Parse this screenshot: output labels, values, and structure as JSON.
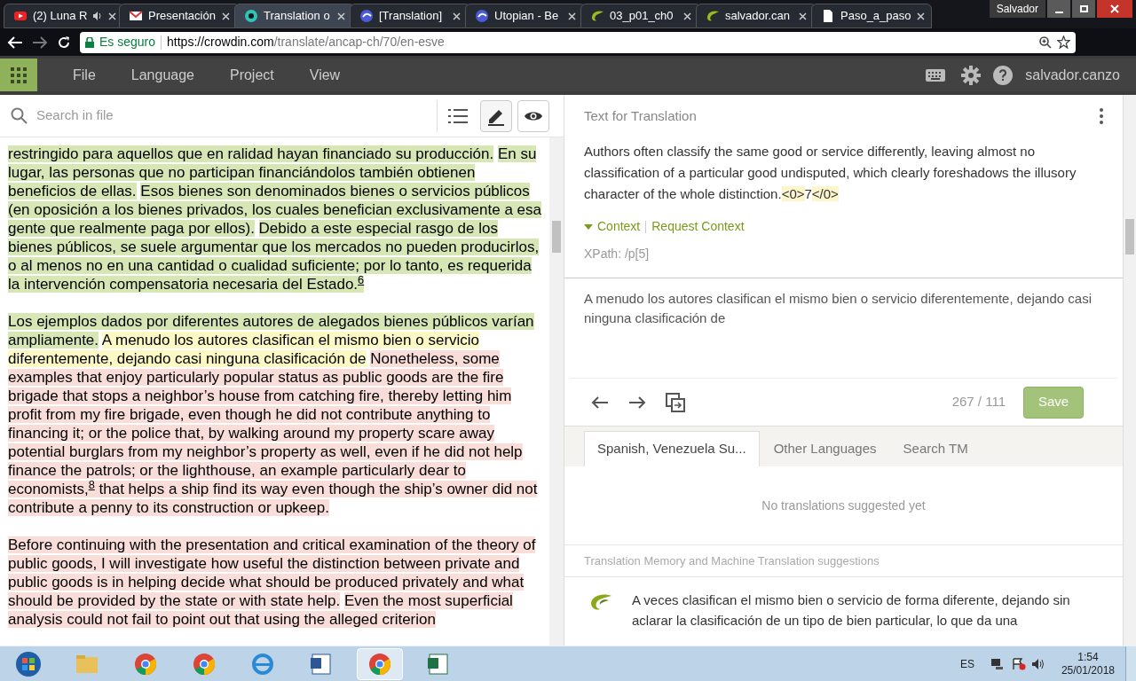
{
  "browser": {
    "tabs": [
      {
        "title": "(2) Luna R",
        "kind": "video",
        "audio": true,
        "selected": false
      },
      {
        "title": "Presentación",
        "kind": "mail",
        "audio": false,
        "selected": false
      },
      {
        "title": "Translation o",
        "kind": "crowdin",
        "audio": false,
        "selected": true
      },
      {
        "title": "[Translation]",
        "kind": "utopian",
        "audio": false,
        "selected": false
      },
      {
        "title": "Utopian - Be",
        "kind": "utopian",
        "audio": false,
        "selected": false
      },
      {
        "title": "03_p01_ch0",
        "kind": "leaf",
        "audio": false,
        "selected": false
      },
      {
        "title": "salvador.can",
        "kind": "leaf",
        "audio": false,
        "selected": false
      },
      {
        "title": "Paso_a_paso",
        "kind": "page",
        "audio": false,
        "selected": false
      }
    ],
    "profile": "Salvador",
    "secure_label": "Es seguro",
    "url_host": "https://crowdin.com",
    "url_path": "/translate/ancap-ch/70/en-esve"
  },
  "menu": {
    "items": [
      "File",
      "Language",
      "Project",
      "View"
    ],
    "user": "salvador.canzo"
  },
  "left": {
    "search": {
      "placeholder": "Search in file"
    },
    "paragraphs": [
      {
        "segments": [
          {
            "text": "restringido para aquellos que en ralidad hayan financiado su producción.",
            "kind": "translated"
          },
          {
            "text": "En su lugar, las personas que no participan financiándolos también obtienen beneficios de ellas.",
            "kind": "translated"
          },
          {
            "text": "Esos bienes son denominados bienes o servicios públicos (en oposición a los bienes privados, los cuales benefician exclusivamente a esa gente que realmente paga por ellos).",
            "kind": "translated"
          },
          {
            "text": "Debido a este especial rasgo de los bienes públicos, se suele argumentar que los mercados no pueden producirlos, o al menos no en una cantidad o cualidad suficiente; por lo tanto, es requerida la intervención compensatoria necesaria del Estado.$^{6}$",
            "kind": "translated"
          }
        ]
      },
      {
        "segments": [
          {
            "text": "Los ejemplos dados por diferentes autores de alegados bienes públicos varían ampliamente.",
            "kind": "translated"
          },
          {
            "text": "A menudo los autores clasifican el mismo bien o servicio diferentemente, dejando casi ninguna clasificación de",
            "kind": "current"
          },
          {
            "text": "Nonetheless, some examples that enjoy particularly popular status as public goods are the fire brigade that stops a neighbor’s house from catching fire, thereby letting him profit from my fire brigade, even though he did not contribute anything to financing it; or the police that, by walking around my property scare away potential burglars from my neighbor’s property as well, even if he did not help finance the patrols; or the lighthouse, an example particularly dear to economists,$^{8}$ that helps a ship find its way even though the ship’s owner did not contribute a penny to its construction or upkeep.",
            "kind": "untranslated"
          }
        ]
      },
      {
        "segments": [
          {
            "text": "Before continuing with the presentation and critical examination of the theory of public goods, I will investigate how useful the distinction between private and public goods is in helping decide what should be produced privately and what should be provided by the state or with state help.",
            "kind": "untranslated"
          },
          {
            "text": "Even the most superficial analysis could not fail to point out that using the alleged criterion",
            "kind": "untranslated"
          }
        ]
      }
    ]
  },
  "right": {
    "header": "Text for Translation",
    "source": "Authors often classify the same good or service differently, leaving almost no classification of a particular good undisputed, which clearly foreshadows the illusory character of the whole distinction.",
    "source_tags": [
      "<0>",
      "7",
      "</0>"
    ],
    "context_label": "Context",
    "request_context": "Request Context",
    "xpath": "XPath: /p[5]",
    "translation": "A menudo los autores clasifican el mismo bien o servicio diferentemente, dejando casi ninguna clasificación de",
    "counter": "267 / 111",
    "save": "Save",
    "tabs": [
      {
        "label": "Spanish, Venezuela Su...",
        "selected": true
      },
      {
        "label": "Other Languages",
        "selected": false
      },
      {
        "label": "Search TM",
        "selected": false
      }
    ],
    "empty_message": "No translations suggested yet",
    "tm_heading": "Translation Memory and Machine Translation suggestions",
    "suggestion": "A veces clasifican el mismo bien o servicio de forma diferente, dejando sin aclarar la clasificación de un tipo de bien particular, lo que da una"
  },
  "taskbar": {
    "apps": [
      {
        "kind": "start",
        "selected": false
      },
      {
        "kind": "folder",
        "selected": false
      },
      {
        "kind": "chrome",
        "selected": false
      },
      {
        "kind": "chrome",
        "selected": false
      },
      {
        "kind": "ie",
        "selected": false
      },
      {
        "kind": "word",
        "selected": false
      },
      {
        "kind": "chrome",
        "selected": true
      },
      {
        "kind": "excel",
        "selected": false
      }
    ],
    "language": "ES",
    "time": "1:54",
    "date": "25/01/2018"
  }
}
